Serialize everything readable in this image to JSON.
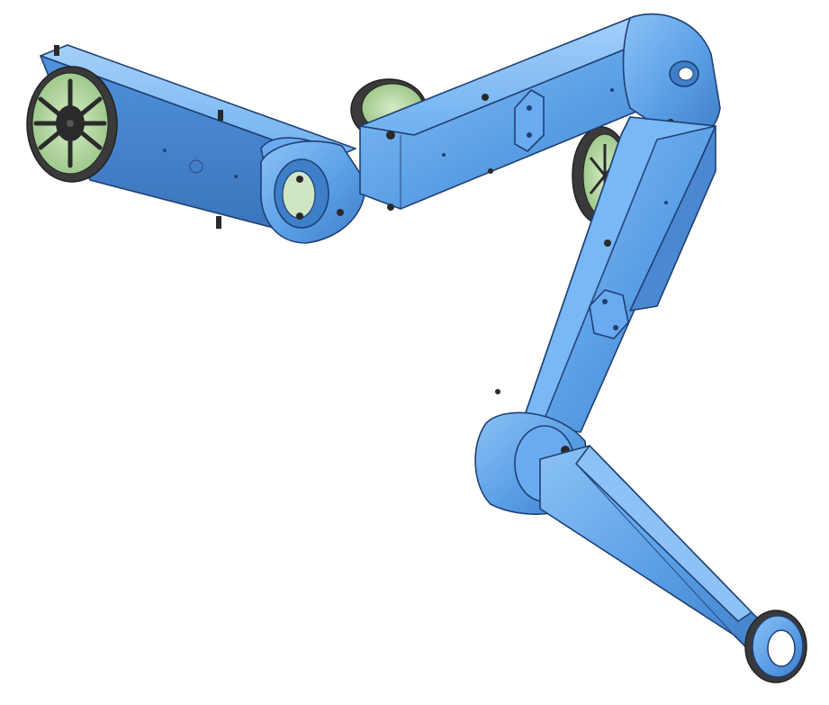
{
  "viewport": {
    "background": "#ffffff"
  },
  "model": {
    "colors": {
      "body": "#5a9fe6",
      "body_light": "#8cc2f6",
      "body_dark": "#3f7ec8",
      "edge": "#1f3f73",
      "motor_rim": "#3a3a3a",
      "motor_face": "#b9d9a6",
      "motor_hub": "#2b2b2b"
    },
    "parts": [
      "base-motor",
      "upper-arm-link",
      "elbow-joint",
      "forearm-link",
      "shoulder-motor",
      "elbow-motor",
      "lower-link",
      "wrist-joint",
      "end-effector-ring"
    ]
  }
}
